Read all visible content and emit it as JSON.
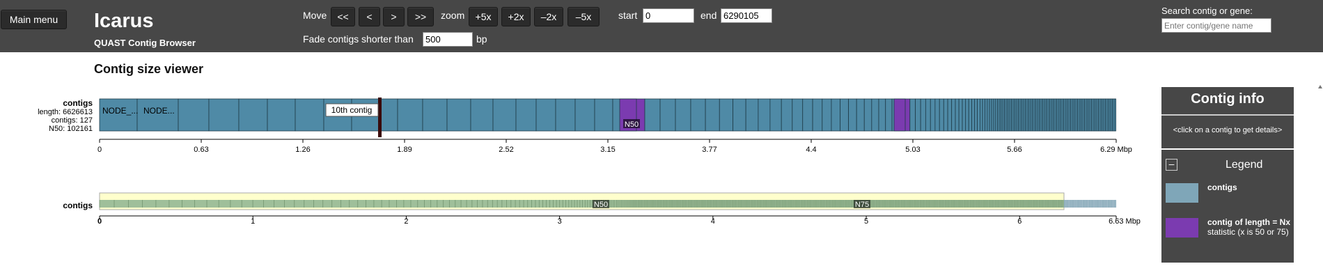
{
  "header": {
    "main_menu": "Main menu",
    "app_title": "Icarus",
    "app_subtitle": "QUAST Contig Browser",
    "move_label": "Move",
    "move_buttons": [
      "<<",
      "<",
      ">",
      ">>"
    ],
    "zoom_label": "zoom",
    "zoom_buttons": [
      "+5x",
      "+2x",
      "–2x",
      "–5x"
    ],
    "start_label": "start",
    "start_value": "0",
    "end_label": "end",
    "end_value": "6290105",
    "fade_label": "Fade contigs shorter than",
    "fade_value": "500",
    "fade_unit": "bp",
    "search_label": "Search contig or gene:",
    "search_placeholder": "Enter contig/gene name"
  },
  "viewer": {
    "title": "Contig size viewer",
    "track_name": "contigs",
    "stats": [
      "length: 6626613",
      "contigs: 127",
      "N50: 102161"
    ],
    "contig_labels": [
      "NODE_...",
      "NODE..."
    ],
    "tooltip": "10th contig",
    "n50_label": "N50",
    "main_ticks": [
      "0",
      "0.63",
      "1.26",
      "1.89",
      "2.52",
      "3.15",
      "3.77",
      "4.4",
      "5.03",
      "5.66",
      "6.29 Mbp"
    ],
    "overview_track_name": "contigs",
    "overview_n50": "N50",
    "overview_n75": "N75",
    "overview_ticks": [
      "0",
      "1",
      "2",
      "3",
      "4",
      "5",
      "6",
      "6.63 Mbp"
    ]
  },
  "sidebar": {
    "info_title": "Contig info",
    "info_hint": "<click on a contig to get details>",
    "legend_collapse": "–",
    "legend_title": "Legend",
    "legend_items": [
      {
        "label": "contigs",
        "color": "#7fa6b8"
      },
      {
        "label": "contig of length = Nx",
        "sub": "statistic (x is 50 or 75)",
        "color": "#7b3bb0"
      }
    ]
  },
  "colors": {
    "contig": "#4f8aa6",
    "nx": "#7b3bb0",
    "overview_bg": "#ffffcc",
    "overview_bar": "#9fbf9a"
  }
}
